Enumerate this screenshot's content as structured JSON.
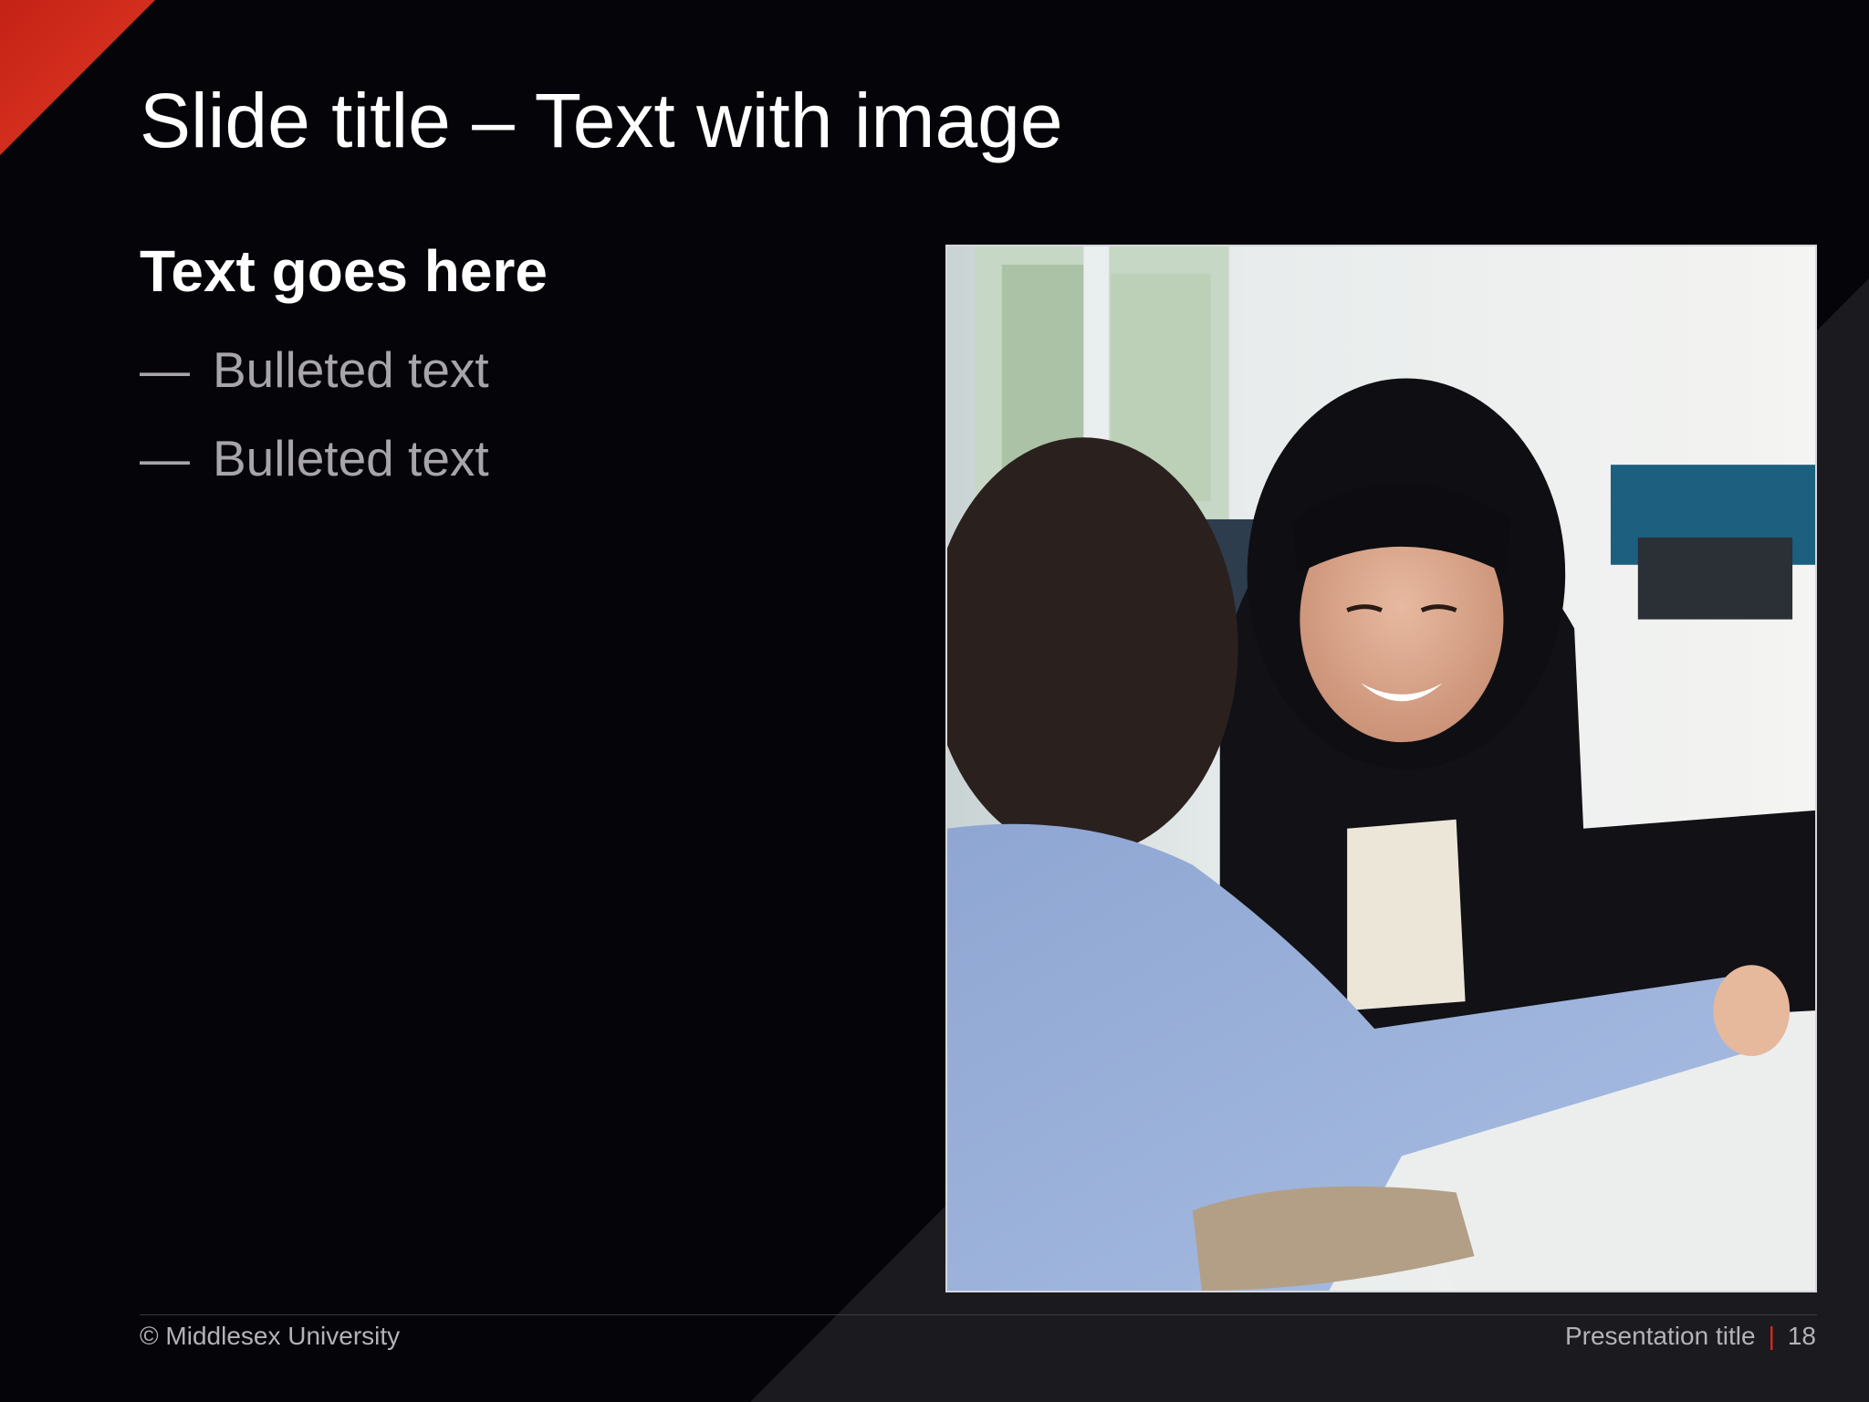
{
  "slide": {
    "title": "Slide title – Text with image",
    "body_heading": "Text goes here",
    "bullets": [
      {
        "marker": "—",
        "text": "Bulleted text"
      },
      {
        "marker": "—",
        "text": "Bulleted text"
      }
    ],
    "image": {
      "description_icon": "photo"
    }
  },
  "footer": {
    "copyright": "© Middlesex University",
    "presentation_title": "Presentation title",
    "separator": "|",
    "page_number": "18"
  },
  "colors": {
    "accent": "#e0281e",
    "background": "#050409",
    "title": "#ffffff",
    "bullet": "#a7a5a9"
  }
}
